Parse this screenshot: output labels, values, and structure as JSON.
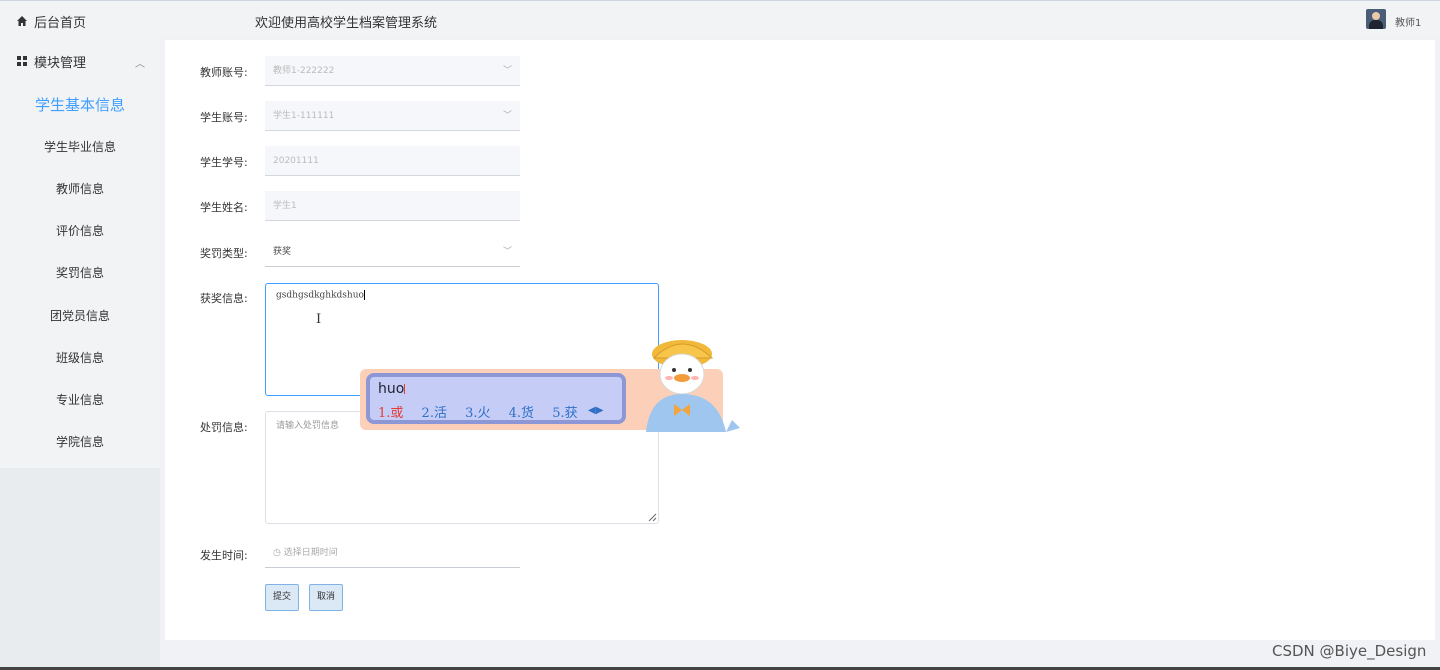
{
  "header": {
    "title": "欢迎使用高校学生档案管理系统",
    "username": "教师1"
  },
  "sidebar": {
    "home_label": "后台首页",
    "group_label": "模块管理",
    "items": [
      {
        "label": "学生基本信息",
        "active": true
      },
      {
        "label": "学生毕业信息"
      },
      {
        "label": "教师信息"
      },
      {
        "label": "评价信息"
      },
      {
        "label": "奖罚信息"
      },
      {
        "label": "团党员信息"
      },
      {
        "label": "班级信息"
      },
      {
        "label": "专业信息"
      },
      {
        "label": "学院信息"
      }
    ]
  },
  "form": {
    "teacher_account": {
      "label": "教师账号:",
      "value": "教师1-222222"
    },
    "student_account": {
      "label": "学生账号:",
      "value": "学生1-111111"
    },
    "student_no": {
      "label": "学生学号:",
      "value": "20201111"
    },
    "student_name": {
      "label": "学生姓名:",
      "value": "学生1"
    },
    "reward_type": {
      "label": "奖罚类型:",
      "value": "获奖"
    },
    "reward_info": {
      "label": "获奖信息:",
      "value": "gsdhgsdkghkdshuo"
    },
    "punish_info": {
      "label": "处罚信息:",
      "placeholder": "请输入处罚信息"
    },
    "date": {
      "label": "发生时间:",
      "placeholder": "选择日期时间"
    },
    "submit_label": "提交",
    "cancel_label": "取消"
  },
  "ime": {
    "input": "huo",
    "candidates": [
      "1.或",
      "2.活",
      "3.火",
      "4.货",
      "5.获"
    ]
  },
  "watermark": "CSDN @Biye_Design",
  "colors": {
    "accent": "#409eff",
    "ime_highlight": "#e53935"
  }
}
